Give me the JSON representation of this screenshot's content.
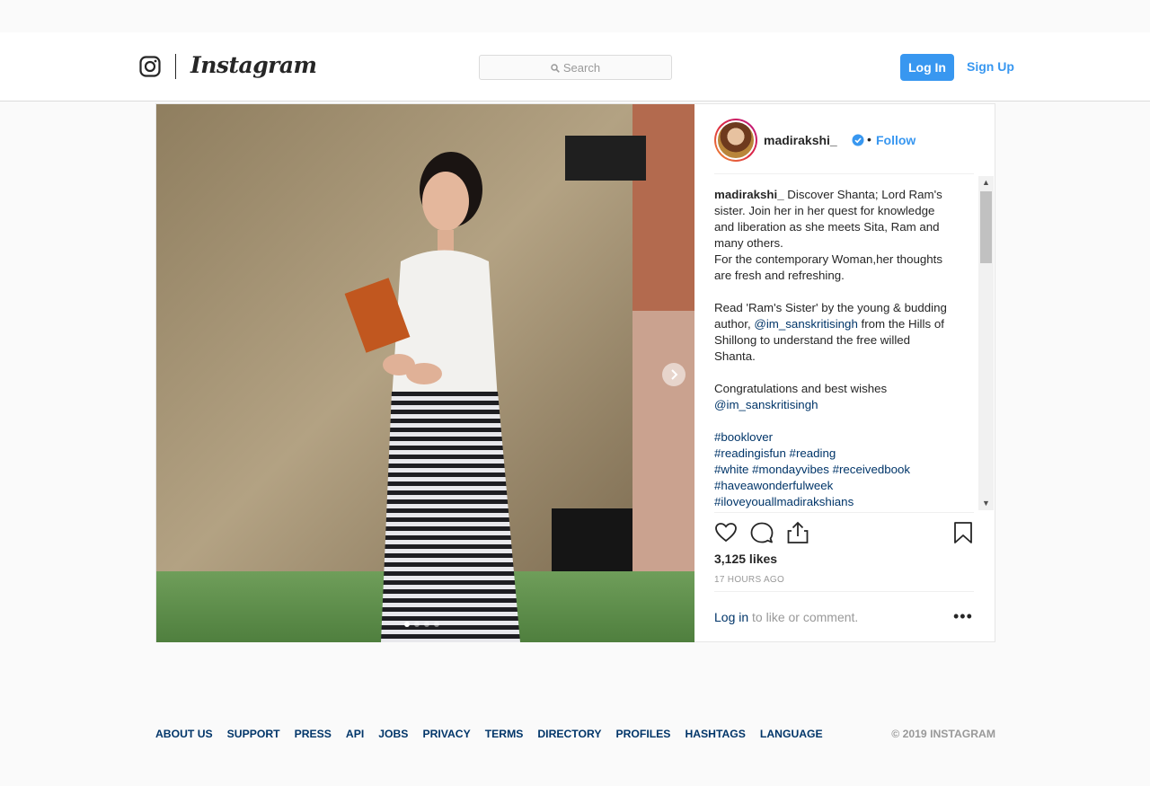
{
  "header": {
    "brand": "Instagram",
    "search_placeholder": "Search",
    "login_label": "Log In",
    "signup_label": "Sign Up"
  },
  "post": {
    "username": "madirakshi_",
    "follow_label": "Follow",
    "separator": "•",
    "caption_lines": [
      [
        {
          "t": "madirakshi_",
          "s": "bold"
        },
        {
          "t": " Discover Shanta; Lord Ram's"
        }
      ],
      [
        {
          "t": "sister. Join her in her quest for knowledge"
        }
      ],
      [
        {
          "t": "and liberation as she meets Sita, Ram and"
        }
      ],
      [
        {
          "t": "many others."
        }
      ],
      [
        {
          "t": "For the contemporary Woman,her thoughts"
        }
      ],
      [
        {
          "t": "are fresh and refreshing."
        }
      ],
      [],
      [
        {
          "t": "Read 'Ram's Sister' by the young & budding"
        }
      ],
      [
        {
          "t": "author, "
        },
        {
          "t": "@im_sanskritisingh",
          "s": "link"
        },
        {
          "t": " from the Hills of"
        }
      ],
      [
        {
          "t": "Shillong to understand the free willed"
        }
      ],
      [
        {
          "t": "Shanta."
        }
      ],
      [],
      [
        {
          "t": "Congratulations and best wishes"
        }
      ],
      [
        {
          "t": "@im_sanskritisingh",
          "s": "link"
        }
      ],
      [],
      [
        {
          "t": "#booklover",
          "s": "link"
        }
      ],
      [
        {
          "t": "#readingisfun",
          "s": "link"
        },
        {
          "t": " "
        },
        {
          "t": "#reading",
          "s": "link"
        }
      ],
      [
        {
          "t": "#white",
          "s": "link"
        },
        {
          "t": " "
        },
        {
          "t": "#mondayvibes",
          "s": "link"
        },
        {
          "t": " "
        },
        {
          "t": "#receivedbook",
          "s": "link"
        }
      ],
      [
        {
          "t": "#haveawonderfulweek",
          "s": "link"
        }
      ],
      [
        {
          "t": "#iloveyouallmadirakshians",
          "s": "link"
        }
      ]
    ],
    "likes": "3,125 likes",
    "time": "17 HOURS AGO",
    "login_link": "Log in",
    "login_suffix": " to like or comment.",
    "more_label": "•••",
    "carousel_slides": 4,
    "carousel_active": 1
  },
  "footer": {
    "links": [
      "ABOUT US",
      "SUPPORT",
      "PRESS",
      "API",
      "JOBS",
      "PRIVACY",
      "TERMS",
      "DIRECTORY",
      "PROFILES",
      "HASHTAGS",
      "LANGUAGE"
    ],
    "copyright": "© 2019 INSTAGRAM"
  },
  "icons": {
    "logo": "instagram-camera-icon",
    "search": "search-icon",
    "verified": "verified-badge-icon",
    "like": "heart-icon",
    "comment": "comment-icon",
    "share": "share-icon",
    "save": "bookmark-icon",
    "next": "chevron-right-icon"
  },
  "colors": {
    "accent": "#3897f0",
    "link": "#003569",
    "muted": "#999999"
  }
}
